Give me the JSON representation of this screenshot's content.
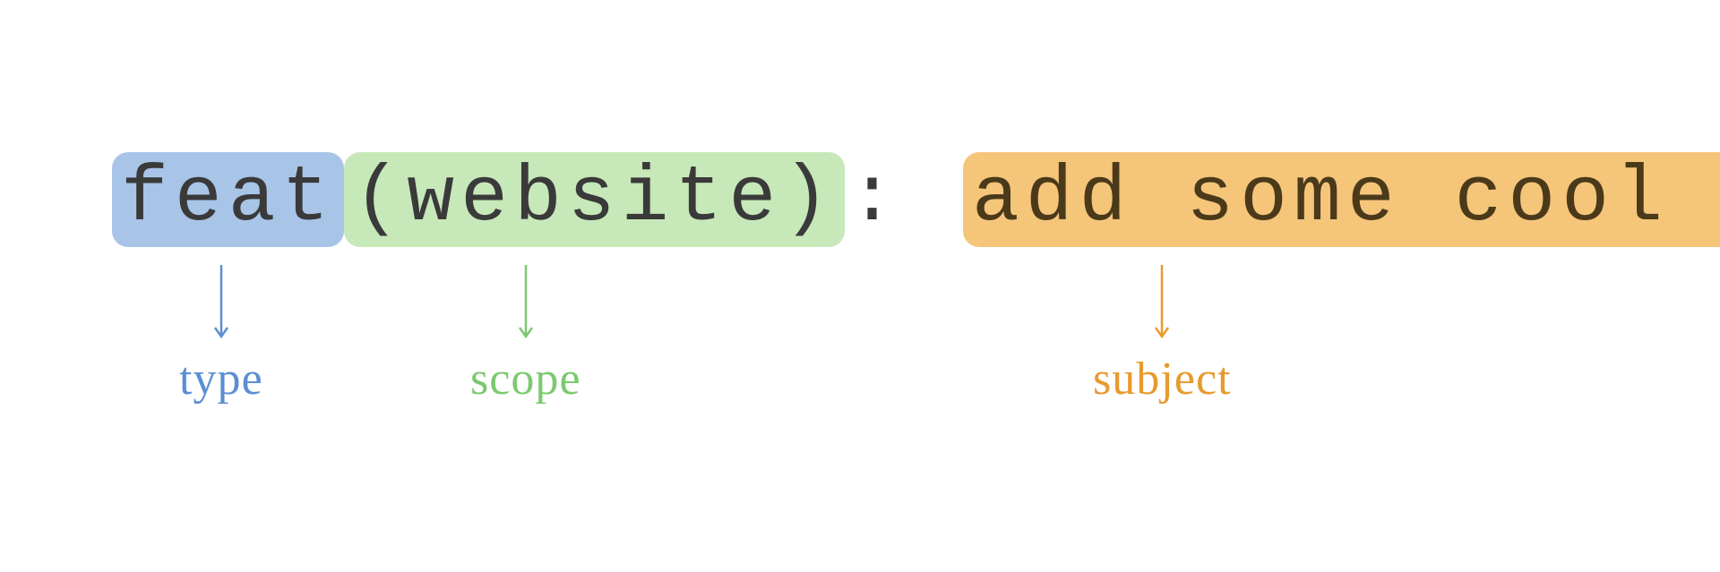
{
  "commit": {
    "type": "feat",
    "scope_open": "(",
    "scope": "website",
    "scope_close": ")",
    "separator": ":",
    "subject": "add some cool stuff"
  },
  "labels": {
    "type": "type",
    "scope": "scope",
    "subject": "subject"
  },
  "colors": {
    "type_bg": "#a8c5e8",
    "scope_bg": "#c7e8b8",
    "subject_bg": "#f5c57a",
    "type_label": "#5a8fd4",
    "scope_label": "#7bc96f",
    "subject_label": "#e89a2e"
  }
}
